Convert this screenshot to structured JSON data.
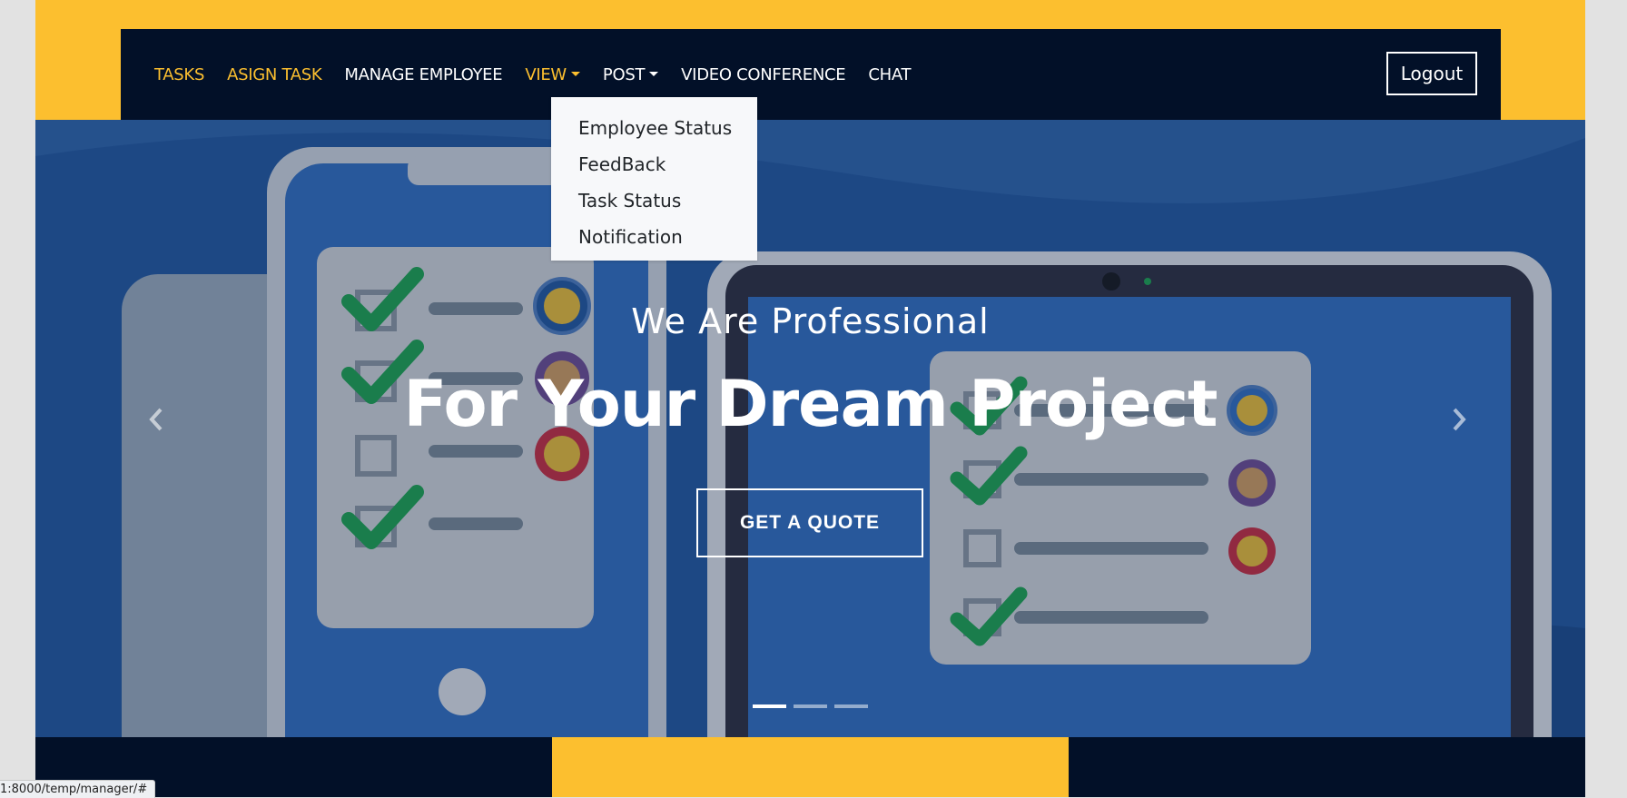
{
  "navbar": {
    "links": [
      {
        "label": "TASKS",
        "active": true
      },
      {
        "label": "ASIGN TASK",
        "active": true
      },
      {
        "label": "MANAGE EMPLOYEE",
        "active": false
      },
      {
        "label": "VIEW",
        "active": true,
        "has_caret": true
      },
      {
        "label": "POST",
        "active": false,
        "has_caret": true
      },
      {
        "label": "VIDEO CONFERENCE",
        "active": false
      },
      {
        "label": "CHAT",
        "active": false
      }
    ],
    "logout_label": "Logout"
  },
  "dropdown": {
    "items": [
      "Employee Status",
      "FeedBack",
      "Task Status",
      "Notification"
    ]
  },
  "hero": {
    "subtitle": "We Are Professional",
    "title": "For Your Dream Project",
    "cta_label": "GET A QUOTE",
    "prev_icon": "chevron-left-icon",
    "next_icon": "chevron-right-icon",
    "indicators": 3,
    "active_indicator": 0
  },
  "status_bar": {
    "url": "1:8000/temp/manager/#"
  },
  "colors": {
    "accent": "#fcbf2f",
    "navbar_bg": "#021028",
    "hero_bg": "#1e56a0"
  }
}
